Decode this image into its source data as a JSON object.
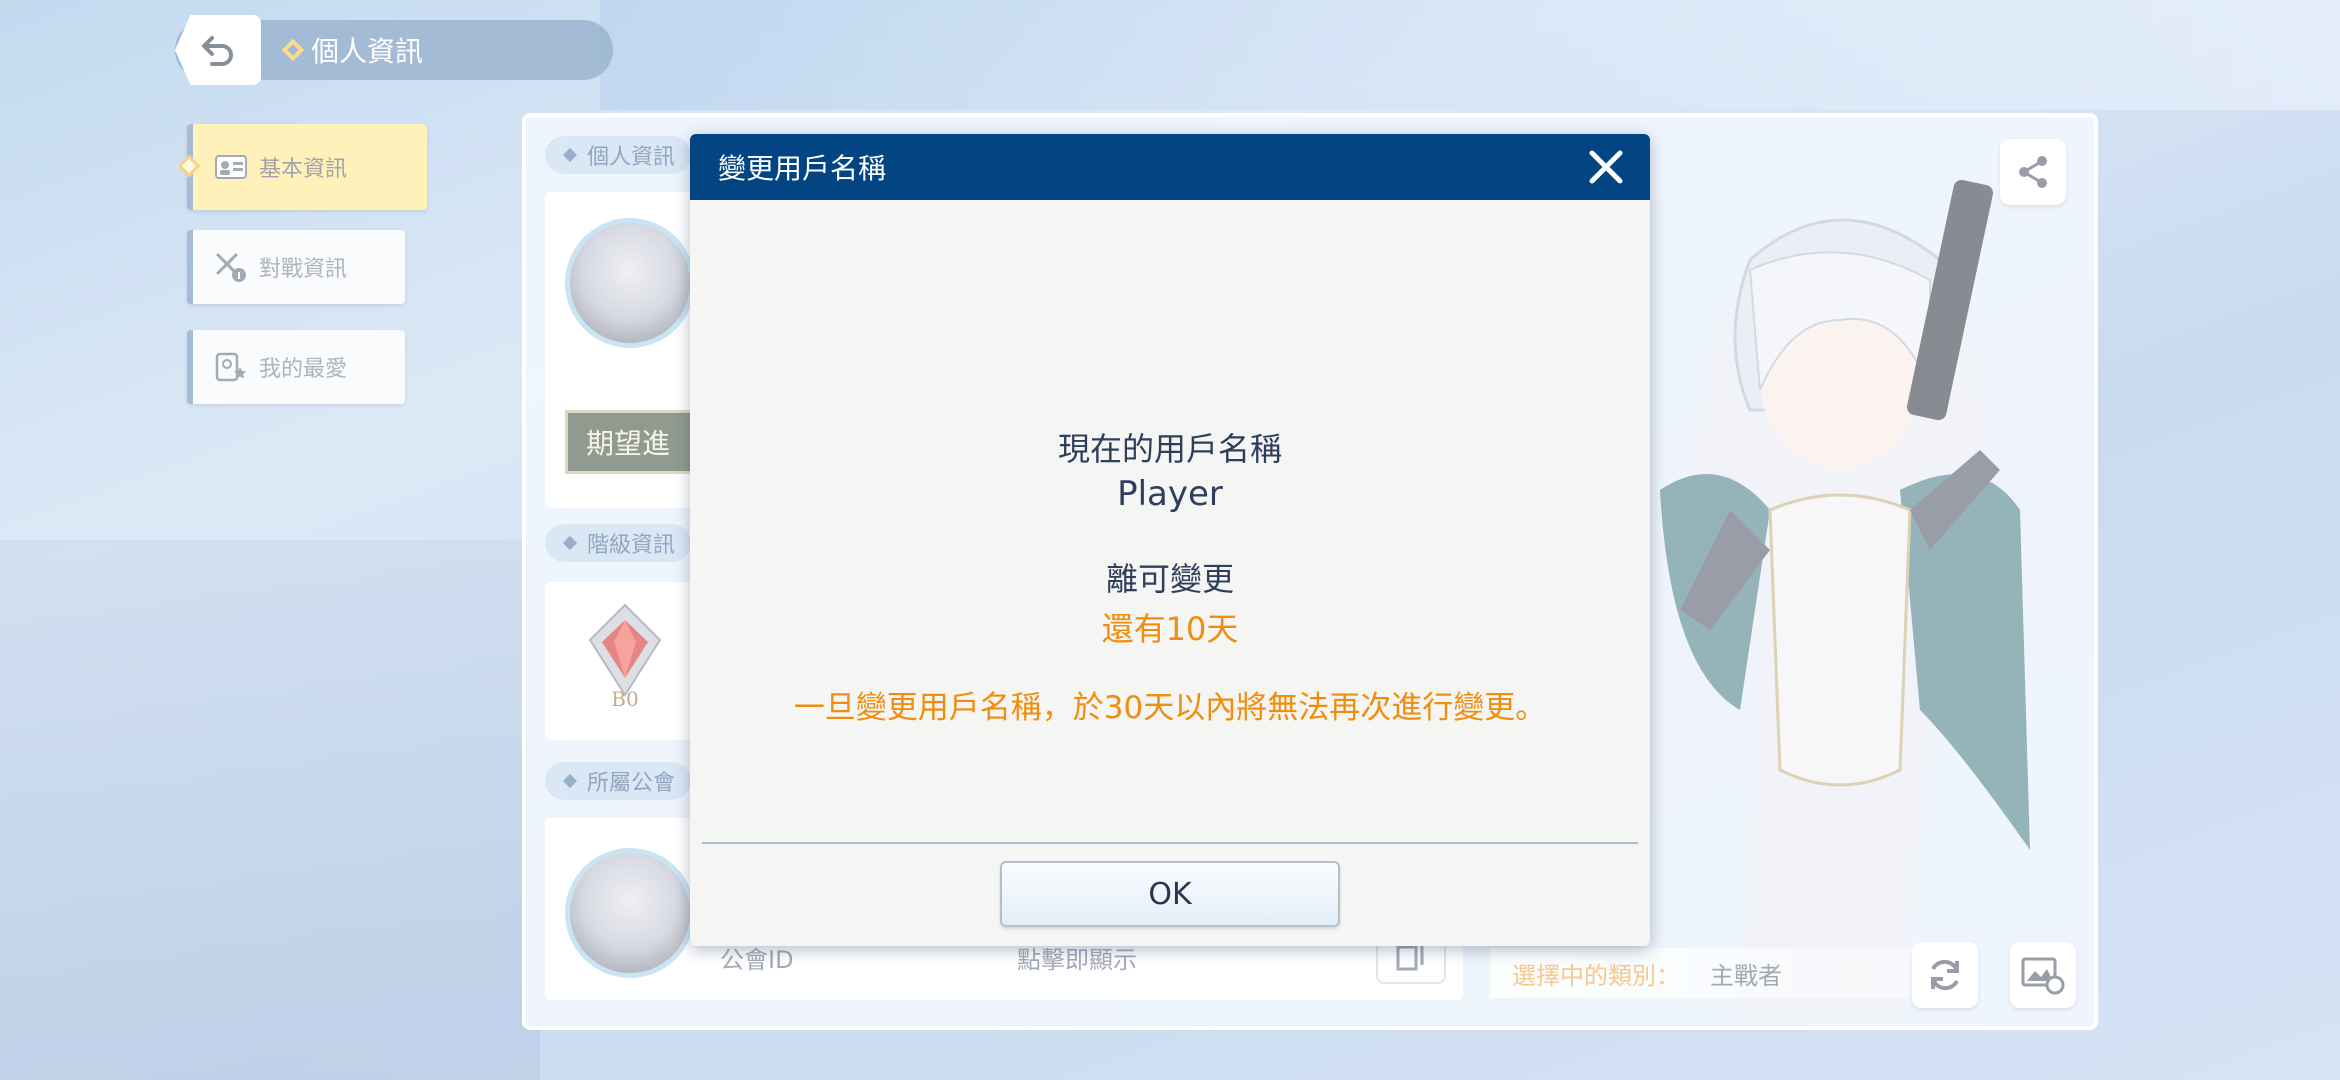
{
  "header": {
    "title": "個人資訊"
  },
  "nav": {
    "items": [
      {
        "label": "基本資訊",
        "icon": "id-card-icon",
        "active": true
      },
      {
        "label": "對戰資訊",
        "icon": "crossed-swords-icon",
        "active": false
      },
      {
        "label": "我的最愛",
        "icon": "favorite-card-icon",
        "active": false
      }
    ]
  },
  "panel": {
    "sections": {
      "profile": "個人資訊",
      "rank": "階級資訊",
      "guild": "所屬公會"
    },
    "plaque_text": "期望進",
    "guild_id_label": "公會ID",
    "guild_id_value": "點擊即顯示",
    "category_label": "選擇中的類別：",
    "category_value": "主戰者"
  },
  "dialog": {
    "title": "變更用戶名稱",
    "current_label": "現在的用戶名稱",
    "current_value": "Player",
    "remain_label": "離可變更",
    "remain_value": "還有10天",
    "warning": "一旦變更用戶名稱，於30天以內將無法再次進行變更。",
    "ok_label": "OK"
  },
  "colors": {
    "dialog_header": "#024582",
    "accent_orange": "#f18d0e",
    "nav_active": "#fde88e"
  }
}
